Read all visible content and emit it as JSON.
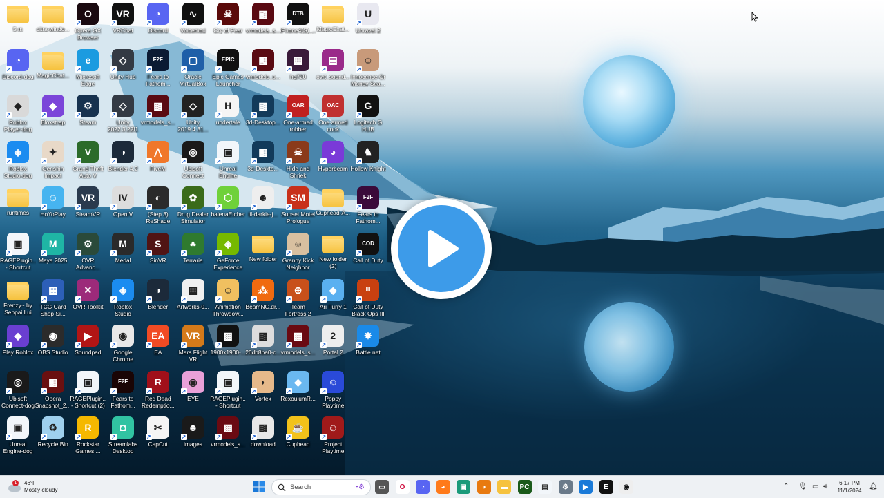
{
  "desktop": {
    "columns": [
      [
        {
          "label": "5 m",
          "icon": "folder-icon",
          "kind": "folder"
        },
        {
          "label": "Discord-dog",
          "icon": "discord-icon",
          "color": "#5865f2",
          "glyph": "◔"
        },
        {
          "label": "Roblox Player-dog",
          "icon": "roblox-icon",
          "color": "#d9d9d9",
          "glyph": "◆"
        },
        {
          "label": "Roblox Studio-dog",
          "icon": "roblox-studio-icon",
          "color": "#1b8cf0",
          "glyph": "◈"
        },
        {
          "label": "runtimes",
          "icon": "folder-icon",
          "kind": "folder"
        },
        {
          "label": "RAGEPlugin... - Shortcut",
          "icon": "rageplugin-icon",
          "color": "#f2f6fa",
          "glyph": "▣"
        },
        {
          "label": "Frenzy~ by Senpai Lui",
          "icon": "folder-icon",
          "kind": "folder"
        },
        {
          "label": "Play Roblox",
          "icon": "bloxstrap-icon",
          "color": "#6a3fd1",
          "glyph": "◆"
        },
        {
          "label": "Ubisoft Connect-dog",
          "icon": "ubisoft-icon",
          "color": "#1a1a1a",
          "glyph": "◎"
        },
        {
          "label": "Unreal Engine-dog",
          "icon": "unreal-icon",
          "color": "#f2f6fa",
          "glyph": "▣"
        }
      ],
      [
        {
          "label": "citra-windo...",
          "icon": "folder-icon",
          "kind": "folder"
        },
        {
          "label": "MagicChat...",
          "icon": "folder-icon",
          "kind": "folder"
        },
        {
          "label": "Bloxstrap",
          "icon": "bloxstrap-icon",
          "color": "#7b45d9",
          "glyph": "◆"
        },
        {
          "label": "Genshin Impact",
          "icon": "genshin-icon",
          "color": "#e8d9c8",
          "glyph": "✦"
        },
        {
          "label": "HoYoPlay",
          "icon": "hoyoplay-icon",
          "color": "#46b4f0",
          "glyph": "☺"
        },
        {
          "label": "Maya 2025",
          "icon": "maya-icon",
          "color": "#1fb5a5",
          "glyph": "M"
        },
        {
          "label": "TCG Card Shop Si...",
          "icon": "tcg-card-shop-icon",
          "color": "#2d5fb8",
          "glyph": "▦"
        },
        {
          "label": "OBS Studio",
          "icon": "obs-icon",
          "color": "#2b2b2b",
          "glyph": "◉"
        },
        {
          "label": "Opera Snapshot_2...",
          "icon": "image-file-icon",
          "color": "#6a1010",
          "glyph": "▩"
        },
        {
          "label": "Recycle Bin",
          "icon": "recycle-bin-icon",
          "color": "#9fd0ee",
          "glyph": "♻"
        }
      ],
      [
        {
          "label": "Opera GX Browser",
          "icon": "opera-gx-icon",
          "color": "#1a0a10",
          "glyph": "O"
        },
        {
          "label": "Microsoft Edge",
          "icon": "edge-icon",
          "color": "#1b9be0",
          "glyph": "e"
        },
        {
          "label": "Steam",
          "icon": "steam-icon",
          "color": "#17324f",
          "glyph": "⚙"
        },
        {
          "label": "Grand Theft Auto V",
          "icon": "gta-icon",
          "color": "#2c6b2a",
          "glyph": "V"
        },
        {
          "label": "SteamVR",
          "icon": "steamvr-icon",
          "color": "#2a3a4e",
          "glyph": "VR"
        },
        {
          "label": "OVR Advanc...",
          "icon": "ovr-advanced-icon",
          "color": "#2a4a3a",
          "glyph": "⚙"
        },
        {
          "label": "OVR Toolkit",
          "icon": "ovr-toolkit-icon",
          "color": "#9c2a7a",
          "glyph": "✕"
        },
        {
          "label": "Soundpad",
          "icon": "soundpad-icon",
          "color": "#b11515",
          "glyph": "▶"
        },
        {
          "label": "RAGEPlugin... - Shortcut (2)",
          "icon": "rageplugin-icon",
          "color": "#f2f6fa",
          "glyph": "▣"
        },
        {
          "label": "Rockstar Games ...",
          "icon": "rockstar-icon",
          "color": "#f5b800",
          "glyph": "R"
        }
      ],
      [
        {
          "label": "VRChat",
          "icon": "vrchat-icon",
          "color": "#111",
          "glyph": "VR"
        },
        {
          "label": "Unity Hub",
          "icon": "unity-hub-icon",
          "color": "#333a44",
          "glyph": "◇"
        },
        {
          "label": "Unity 2022.3.22f1",
          "icon": "unity-icon",
          "color": "#333a44",
          "glyph": "◇"
        },
        {
          "label": "Blender 4.2",
          "icon": "blender-icon",
          "color": "#1c2a3a",
          "glyph": "◑"
        },
        {
          "label": "OpenIV",
          "icon": "openiv-icon",
          "color": "#ddd",
          "glyph": "IV"
        },
        {
          "label": "Medal",
          "icon": "medal-icon",
          "color": "#2a2a2a",
          "glyph": "M"
        },
        {
          "label": "Roblox Studio",
          "icon": "roblox-studio-icon",
          "color": "#1b8cf0",
          "glyph": "◈"
        },
        {
          "label": "Google Chrome",
          "icon": "chrome-icon",
          "color": "#e8e8e8",
          "glyph": "◉"
        },
        {
          "label": "Fears to Fathom...",
          "icon": "fears-to-fathom-icon",
          "color": "#1a0505",
          "glyph": "F2F"
        },
        {
          "label": "Streamlabs Desktop",
          "icon": "streamlabs-icon",
          "color": "#31c3a2",
          "glyph": "◘"
        }
      ],
      [
        {
          "label": "Discord",
          "icon": "discord-icon",
          "color": "#5865f2",
          "glyph": "◔"
        },
        {
          "label": "Fears to Fathom...",
          "icon": "fears-to-fathom-icon",
          "color": "#0b1a33",
          "glyph": "F2F"
        },
        {
          "label": "vrmodels_s...",
          "icon": "image-file-icon",
          "color": "#5a0a12",
          "glyph": "▩"
        },
        {
          "label": "FiveM",
          "icon": "fivem-icon",
          "color": "#f0772a",
          "glyph": "⋀"
        },
        {
          "label": "(Step 3) ReShade",
          "icon": "reshade-icon",
          "color": "#2b2b2b",
          "glyph": "◐"
        },
        {
          "label": "SinVR",
          "icon": "sinvr-icon",
          "color": "#501414",
          "glyph": "S"
        },
        {
          "label": "Blender",
          "icon": "blender-icon",
          "color": "#1c2a3a",
          "glyph": "◑"
        },
        {
          "label": "EA",
          "icon": "ea-icon",
          "color": "#f14b24",
          "glyph": "EA"
        },
        {
          "label": "Red Dead Redemptio...",
          "icon": "rdr-icon",
          "color": "#a0101a",
          "glyph": "R"
        },
        {
          "label": "CapCut",
          "icon": "capcut-icon",
          "color": "#f5f5f5",
          "glyph": "✂"
        }
      ],
      [
        {
          "label": "Voicemod",
          "icon": "voicemod-icon",
          "color": "#111",
          "glyph": "∿"
        },
        {
          "label": "Oracle VirtualBox",
          "icon": "virtualbox-icon",
          "color": "#1f5fa8",
          "glyph": "▢"
        },
        {
          "label": "Unity 2019.4.31...",
          "icon": "unity-icon",
          "color": "#222",
          "glyph": "◇"
        },
        {
          "label": "Ubisoft Connect",
          "icon": "ubisoft-icon",
          "color": "#1a1a1a",
          "glyph": "◎"
        },
        {
          "label": "Drug Dealer Simulator",
          "icon": "drug-dealer-icon",
          "color": "#3a6b1a",
          "glyph": "✿"
        },
        {
          "label": "Terraria",
          "icon": "terraria-icon",
          "color": "#2f7a2f",
          "glyph": "♣"
        },
        {
          "label": "Artworks-0...",
          "icon": "image-file-icon",
          "color": "#f0f0f0",
          "glyph": "▩"
        },
        {
          "label": "Mars Flight VR",
          "icon": "mars-flight-icon",
          "color": "#d47a1a",
          "glyph": "VR"
        },
        {
          "label": "EYE",
          "icon": "eye-icon",
          "color": "#e8a0d8",
          "glyph": "◉"
        },
        {
          "label": "images",
          "icon": "image-file-icon",
          "color": "#1a1a1a",
          "glyph": "☻"
        }
      ],
      [
        {
          "label": "Cry of Fear",
          "icon": "cry-of-fear-icon",
          "color": "#5a0a0a",
          "glyph": "☠"
        },
        {
          "label": "Epic Games Launcher",
          "icon": "epic-games-icon",
          "color": "#111",
          "glyph": "EPIC"
        },
        {
          "label": "undertale",
          "icon": "undertale-icon",
          "color": "#f5f5f5",
          "glyph": "H"
        },
        {
          "label": "Unreal Engine",
          "icon": "unreal-icon",
          "color": "#f2f6fa",
          "glyph": "▣"
        },
        {
          "label": "balenaEtcher",
          "icon": "balena-etcher-icon",
          "color": "#6fd13a",
          "glyph": "⬡"
        },
        {
          "label": "GeForce Experience",
          "icon": "geforce-icon",
          "color": "#76b900",
          "glyph": "◈"
        },
        {
          "label": "Animation Throwdow...",
          "icon": "animation-throwdown-icon",
          "color": "#f0c060",
          "glyph": "☺"
        },
        {
          "label": "1900x1900-...",
          "icon": "image-file-icon",
          "color": "#111",
          "glyph": "▩"
        },
        {
          "label": "RAGEPlugin... - Shortcut",
          "icon": "rageplugin-icon",
          "color": "#f2f6fa",
          "glyph": "▣"
        },
        {
          "label": "vrmodels_s...",
          "icon": "image-file-icon",
          "color": "#6a0a12",
          "glyph": "▩"
        }
      ],
      [
        {
          "label": "vrmodels_s...",
          "icon": "image-file-icon",
          "color": "#5a0a12",
          "glyph": "▩"
        },
        {
          "label": "vrmodels_s...",
          "icon": "image-file-icon",
          "color": "#5a0a12",
          "glyph": "▩"
        },
        {
          "label": "3d-Desktop...",
          "icon": "image-file-icon",
          "color": "#123a5a",
          "glyph": "▩"
        },
        {
          "label": "3d-Deskto...",
          "icon": "image-file-icon",
          "color": "#123a5a",
          "glyph": "▩"
        },
        {
          "label": "lil-darkie-j...",
          "icon": "image-file-icon",
          "color": "#eee",
          "glyph": "☻"
        },
        {
          "label": "New folder",
          "icon": "folder-icon",
          "kind": "folder"
        },
        {
          "label": "BeamNG.dr...",
          "icon": "beamng-icon",
          "color": "#f06a10",
          "glyph": "⁂"
        },
        {
          "label": "26db8ba0-c...",
          "icon": "image-file-icon",
          "color": "#ddd",
          "glyph": "▩"
        },
        {
          "label": "Vortex",
          "icon": "vortex-icon",
          "color": "#e6b98a",
          "glyph": "◗"
        },
        {
          "label": "download",
          "icon": "image-file-icon",
          "color": "#e8e8e8",
          "glyph": "▩"
        }
      ],
      [
        {
          "label": "iPhone4(S)_...",
          "icon": "dtb-file-icon",
          "color": "#111",
          "glyph": "DTB"
        },
        {
          "label": "hq720",
          "icon": "image-file-icon",
          "color": "#3a1a3a",
          "glyph": "▩"
        },
        {
          "label": "One-armed robber",
          "icon": "one-armed-robber-icon",
          "color": "#c02020",
          "glyph": "OAR"
        },
        {
          "label": "Hide and Shriek",
          "icon": "hide-and-shriek-icon",
          "color": "#8a3a1a",
          "glyph": "☠"
        },
        {
          "label": "Sunset Motel Prologue",
          "icon": "sunset-motel-icon",
          "color": "#c8301a",
          "glyph": "SM"
        },
        {
          "label": "Granny Kick Neighbor",
          "icon": "granny-kick-icon",
          "color": "#d8c0a0",
          "glyph": "☺"
        },
        {
          "label": "Team Fortress 2",
          "icon": "tf2-icon",
          "color": "#c8501a",
          "glyph": "⊕"
        },
        {
          "label": "vrmodels_s...",
          "icon": "image-file-icon",
          "color": "#6a0a12",
          "glyph": "▩"
        },
        {
          "label": "RexouiumR...",
          "icon": "rexouium-icon",
          "color": "#6ab8f0",
          "glyph": "◆"
        },
        {
          "label": "Cuphead",
          "icon": "cuphead-icon",
          "color": "#f2c21a",
          "glyph": "☕"
        }
      ],
      [
        {
          "label": "MagicChat...",
          "icon": "folder-icon",
          "kind": "folder"
        },
        {
          "label": "ovrt_sound...",
          "icon": "winrar-icon",
          "color": "#9a2a8a",
          "glyph": "▤"
        },
        {
          "label": "One-armed cook",
          "icon": "one-armed-cook-icon",
          "color": "#c03030",
          "glyph": "OAC"
        },
        {
          "label": "Hyperbeam",
          "icon": "hyperbeam-icon",
          "color": "#7a3ad8",
          "glyph": "◕"
        },
        {
          "label": "Cuphead-A...",
          "icon": "folder-icon",
          "kind": "folder"
        },
        {
          "label": "New folder (2)",
          "icon": "folder-icon",
          "kind": "folder"
        },
        {
          "label": "Ari Furry 1",
          "icon": "ari-furry-icon",
          "color": "#5ab0f0",
          "glyph": "◆"
        },
        {
          "label": "Portal 2",
          "icon": "portal2-icon",
          "color": "#eee",
          "glyph": "2"
        },
        {
          "label": "Poppy Playtime",
          "icon": "poppy-playtime-icon",
          "color": "#2a4ad8",
          "glyph": "☺"
        },
        {
          "label": "Project Playtime",
          "icon": "project-playtime-icon",
          "color": "#a01a1a",
          "glyph": "☺"
        }
      ],
      [
        {
          "label": "Unravel 2",
          "icon": "unravel-icon",
          "color": "#e8e8f0",
          "glyph": "U"
        },
        {
          "label": "Innocence Or Money Sea...",
          "icon": "innocence-or-money-icon",
          "color": "#c89a7a",
          "glyph": "☺"
        },
        {
          "label": "Logitech G HUB",
          "icon": "logitech-icon",
          "color": "#111",
          "glyph": "G"
        },
        {
          "label": "Hollow Knight",
          "icon": "hollow-knight-icon",
          "color": "#222",
          "glyph": "♞"
        },
        {
          "label": "Fears to Fathom...",
          "icon": "fears-to-fathom-icon",
          "color": "#3a0a3a",
          "glyph": "F2F"
        },
        {
          "label": "Call of Duty",
          "icon": "call-of-duty-icon",
          "color": "#111",
          "glyph": "COD"
        },
        {
          "label": "Call of Duty Black Ops III",
          "icon": "black-ops-icon",
          "color": "#c84010",
          "glyph": "III"
        },
        {
          "label": "Battle.net",
          "icon": "battlenet-icon",
          "color": "#1a8ae8",
          "glyph": "✸"
        }
      ]
    ]
  },
  "video": {
    "play_icon": "play-icon"
  },
  "taskbar": {
    "weather": {
      "temp": "46°F",
      "condition": "Mostly cloudy",
      "alert_count": "1"
    },
    "search": {
      "placeholder": "Search"
    },
    "clock": {
      "time": "6:17 PM",
      "date": "11/1/2024"
    },
    "pinned": [
      {
        "name": "file-explorer-icon",
        "color": "#555",
        "glyph": "▭"
      },
      {
        "name": "opera-gx-icon",
        "color": "#fff",
        "glyph": "O",
        "fg": "#d01040"
      },
      {
        "name": "discord-icon",
        "color": "#5865f2",
        "glyph": "◔"
      },
      {
        "name": "firefox-icon",
        "color": "#ff7a1a",
        "glyph": "◕"
      },
      {
        "name": "monitor-icon",
        "color": "#1a9a7a",
        "glyph": "▣"
      },
      {
        "name": "blender-icon",
        "color": "#e87a10",
        "glyph": "◑"
      },
      {
        "name": "folder-icon",
        "color": "#f6c23e",
        "glyph": "▬"
      },
      {
        "name": "pycharm-icon",
        "color": "#1a5a1a",
        "glyph": "PC"
      },
      {
        "name": "notepad-icon",
        "color": "#f2f6fa",
        "glyph": "▤",
        "fg": "#333"
      },
      {
        "name": "settings-icon",
        "color": "#6a7a8a",
        "glyph": "⚙"
      },
      {
        "name": "media-icon",
        "color": "#1a7ad8",
        "glyph": "▶"
      },
      {
        "name": "epic-games-icon",
        "color": "#111",
        "glyph": "E"
      },
      {
        "name": "opera-gx-active-icon",
        "color": "#eee",
        "glyph": "◉",
        "fg": "#111"
      }
    ]
  }
}
